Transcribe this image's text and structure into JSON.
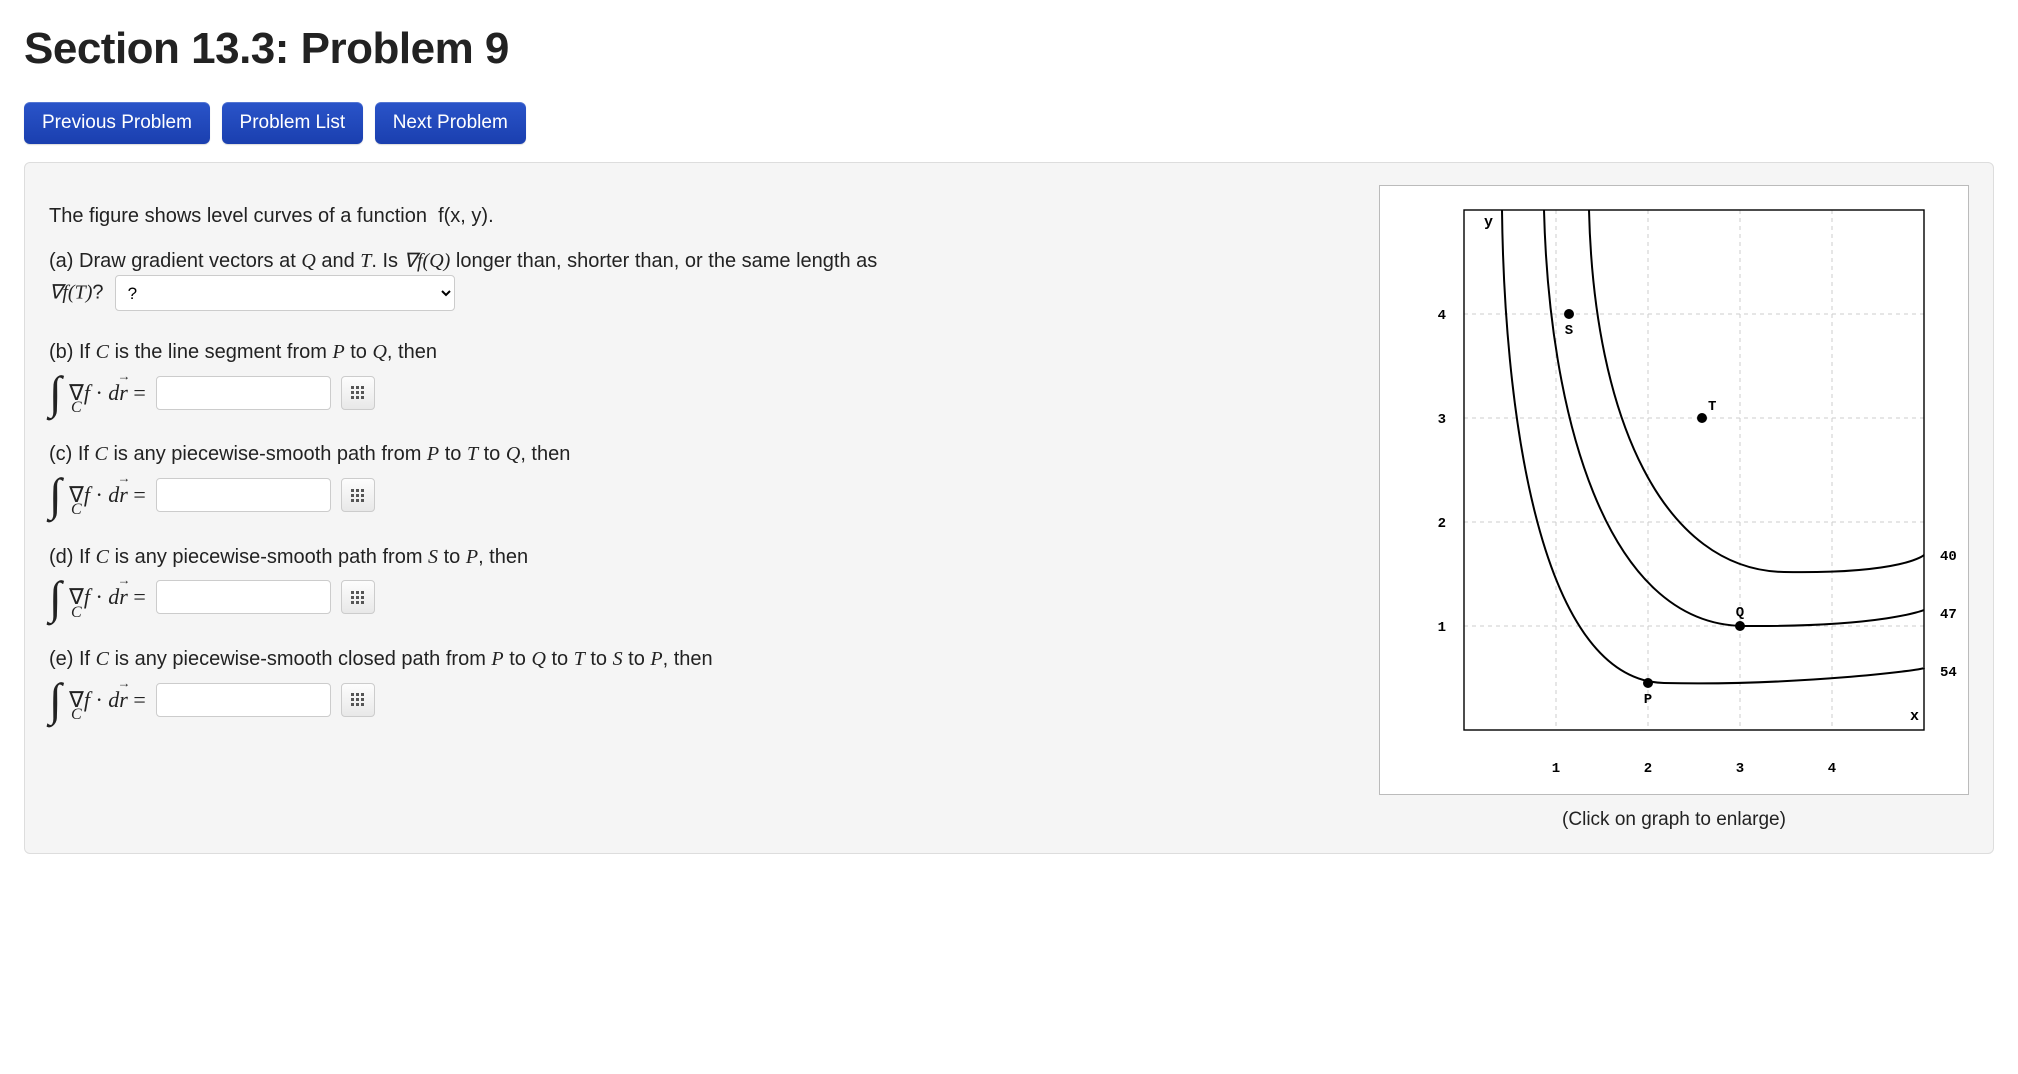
{
  "title": "Section 13.3: Problem 9",
  "nav": {
    "prev": "Previous Problem",
    "list": "Problem List",
    "next": "Next Problem"
  },
  "intro": "The figure shows level curves of a function  f(x, y).",
  "parts": {
    "a": {
      "pre": "(a) Draw gradient vectors at ",
      "mid1": " and ",
      "mid2": ". Is ",
      "mid3": " longer than, shorter than, or the same length as ",
      "post": "?",
      "select_placeholder": "?"
    },
    "b": {
      "pre": "(b) If ",
      "mid1": " is the line segment from ",
      "mid2": " to ",
      "post": ", then"
    },
    "c": {
      "pre": "(c) If ",
      "mid1": " is any piecewise-smooth path from ",
      "mid2": " to ",
      "mid3": " to ",
      "post": ", then"
    },
    "d": {
      "pre": "(d) If ",
      "mid1": " is any piecewise-smooth path from ",
      "mid2": " to ",
      "post": ", then"
    },
    "e": {
      "pre": "(e) If ",
      "mid1": " is any piecewise-smooth closed path from ",
      "mid2": " to ",
      "mid3": " to ",
      "mid4": " to ",
      "mid5": " to ",
      "post": ", then"
    }
  },
  "vars": {
    "Q": "Q",
    "T": "T",
    "P": "P",
    "S": "S",
    "C": "C",
    "gradfQ": "∇f(Q)",
    "gradfT": "∇f(T)",
    "integrand_nabla": "∇",
    "integrand_f": "f",
    "integrand_dot": "·",
    "integrand_d": "d",
    "integrand_r": "r",
    "equals": "="
  },
  "graph": {
    "xlabel": "x",
    "ylabel": "y",
    "xticks": [
      "1",
      "2",
      "3",
      "4"
    ],
    "yticks": [
      "1",
      "2",
      "3",
      "4"
    ],
    "levels": [
      "40",
      "47",
      "54"
    ],
    "points": {
      "P": "P",
      "Q": "Q",
      "S": "S",
      "T": "T"
    },
    "caption": "(Click on graph to enlarge)"
  }
}
